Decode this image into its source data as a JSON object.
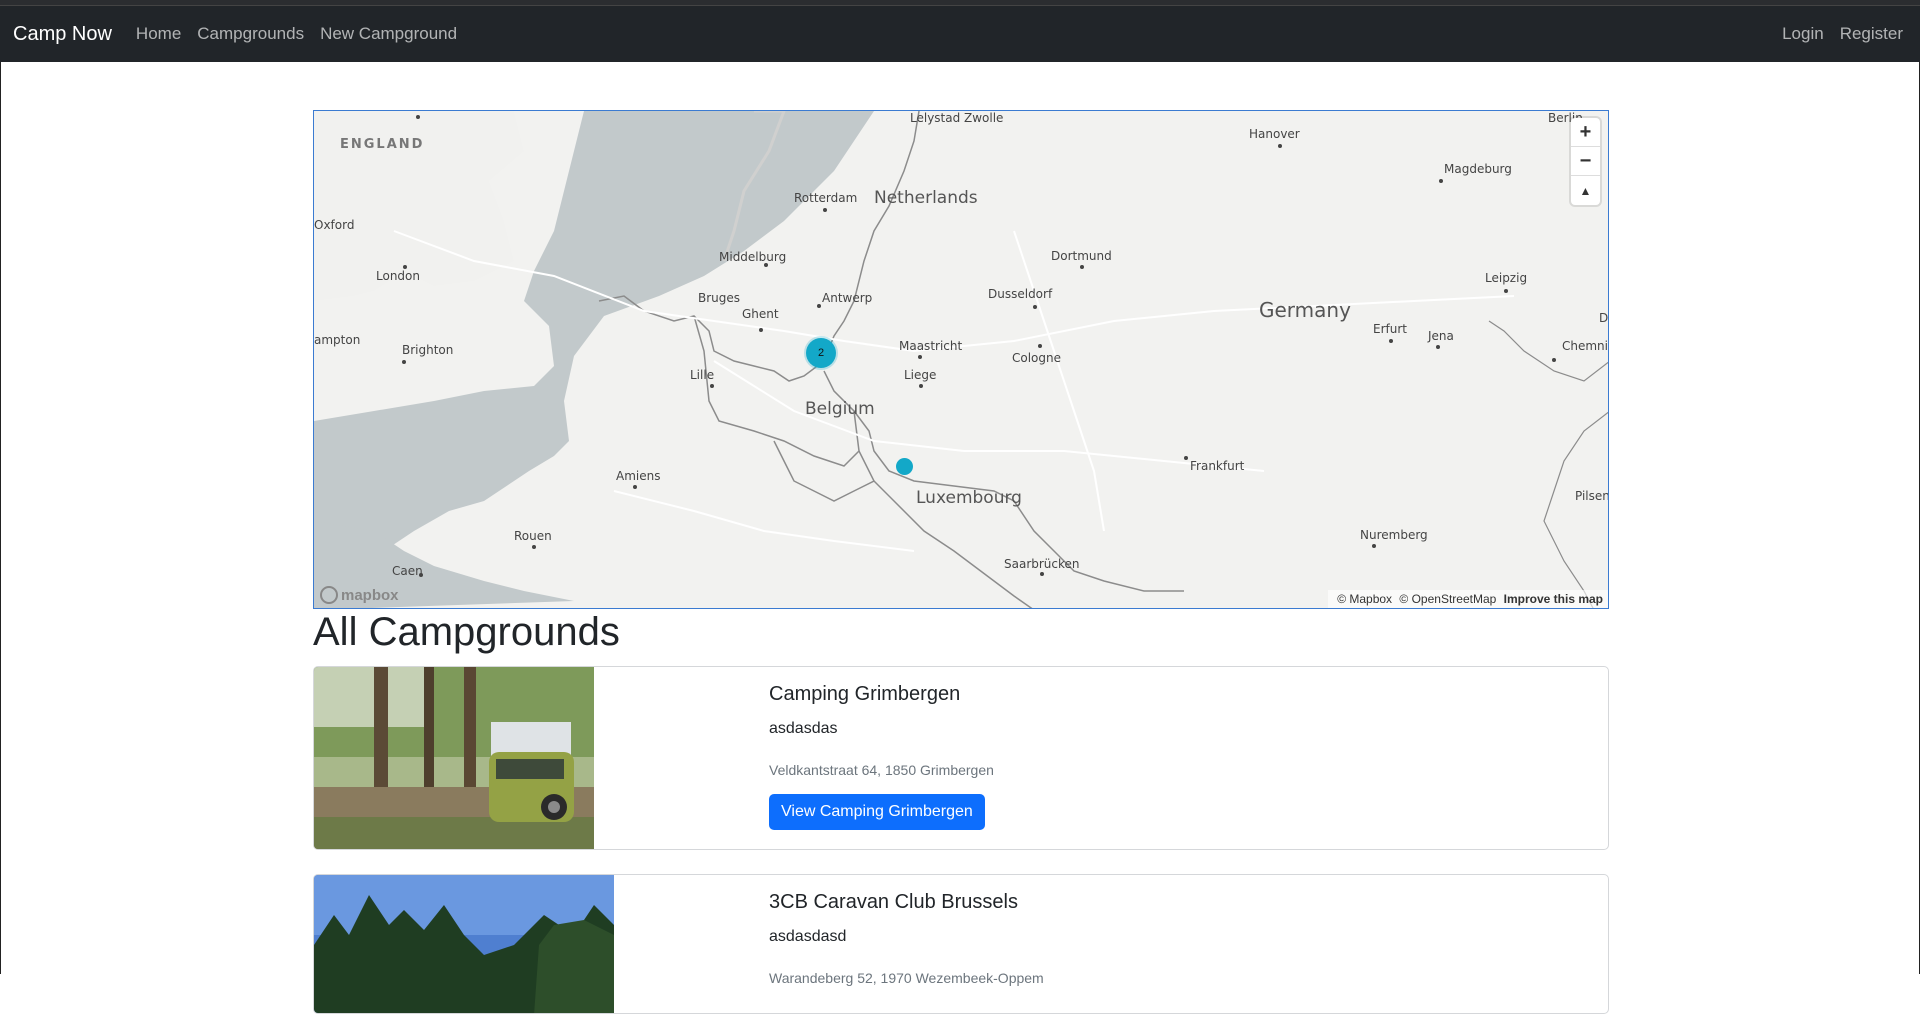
{
  "navbar": {
    "brand": "Camp Now",
    "links": [
      "Home",
      "Campgrounds",
      "New Campground"
    ],
    "login": "Login",
    "register": "Register"
  },
  "map": {
    "countries": {
      "netherlands": "Netherlands",
      "belgium": "Belgium",
      "germany": "Germany",
      "luxembourg": "Luxembourg",
      "england": "ENGLAND"
    },
    "cities": {
      "lelystad": "Lelystad",
      "zwolle": "Zwolle",
      "hanover": "Hanover",
      "berlin": "Berlin",
      "magdeburg": "Magdeburg",
      "rotterdam": "Rotterdam",
      "oxford": "Oxford",
      "london": "London",
      "middelburg": "Middelburg",
      "dortmund": "Dortmund",
      "bruges": "Bruges",
      "antwerp": "Antwerp",
      "ghent": "Ghent",
      "dusseldorf": "Dusseldorf",
      "leipzig": "Leipzig",
      "ampton": "ampton",
      "brighton": "Brighton",
      "maastricht": "Maastricht",
      "cologne": "Cologne",
      "erfurt": "Erfurt",
      "jena": "Jena",
      "chemnitz": "Chemnitz",
      "lille": "Lille",
      "liege": "Liege",
      "amiens": "Amiens",
      "frankfurt": "Frankfurt",
      "pilsen": "Pilsen",
      "rouen": "Rouen",
      "nuremberg": "Nuremberg",
      "caen": "Caen",
      "saarbrucken": "Saarbrücken",
      "d": "D"
    },
    "cluster_count": "2",
    "zoom_in": "+",
    "zoom_out": "−",
    "compass": "▲",
    "attribution": {
      "mapbox": "© Mapbox",
      "osm": "© OpenStreetMap",
      "improve": "Improve this map"
    },
    "logo": "mapbox"
  },
  "page_title": "All Campgrounds",
  "campgrounds": [
    {
      "title": "Camping Grimbergen",
      "description": "asdasdas",
      "location": "Veldkantstraat 64, 1850 Grimbergen",
      "button": "View Camping Grimbergen"
    },
    {
      "title": "3CB Caravan Club Brussels",
      "description": "asdasdasd",
      "location": "Warandeberg 52, 1970 Wezembeek-Oppem"
    }
  ]
}
